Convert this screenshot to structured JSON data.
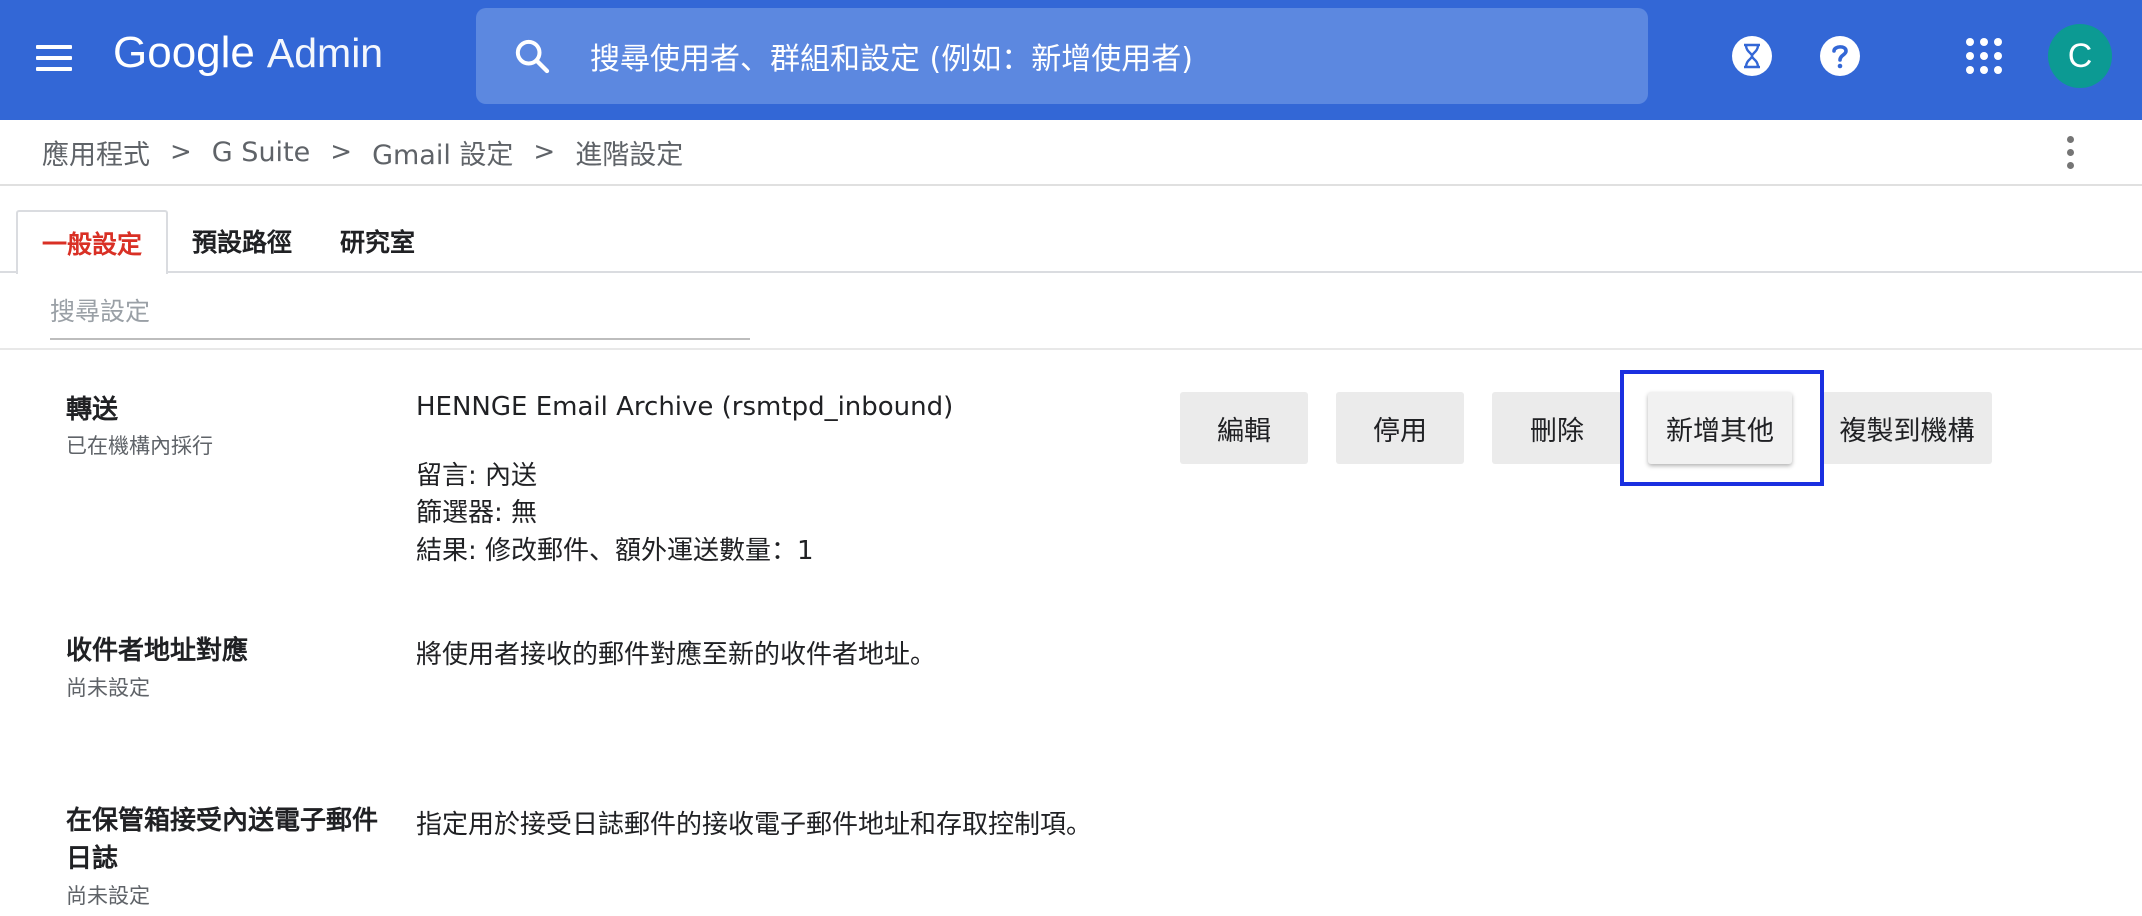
{
  "header": {
    "logo_google": "Google",
    "logo_admin": "Admin",
    "search_placeholder": "搜尋使用者、群組和設定 (例如：新增使用者)",
    "avatar_letter": "C",
    "icons": [
      "menu-icon",
      "search-icon",
      "hourglass-icon",
      "help-icon",
      "apps-icon"
    ]
  },
  "breadcrumb": {
    "items": [
      "應用程式",
      "G Suite",
      "Gmail 設定",
      "進階設定"
    ],
    "separator": ">"
  },
  "tabs": [
    {
      "label": "一般設定",
      "active": true
    },
    {
      "label": "預設路徑",
      "active": false
    },
    {
      "label": "研究室",
      "active": false
    }
  ],
  "settings_search": {
    "placeholder": "搜尋設定"
  },
  "settings": [
    {
      "title": "轉送",
      "status": "已在機構內採行",
      "rule_name": "HENNGE Email Archive (rsmtpd_inbound)",
      "details": [
        "留言:  內送",
        "篩選器:  無",
        "結果:  修改郵件、額外運送數量：1"
      ],
      "buttons": [
        "編輯",
        "停用",
        "刪除",
        "新增其他",
        "複製到機構"
      ]
    },
    {
      "title": "收件者地址對應",
      "status": "尚未設定",
      "description": "將使用者接收的郵件對應至新的收件者地址。"
    },
    {
      "title_line1": "在保管箱接受內送電子郵件",
      "title_line2": "日誌",
      "status": "尚未設定",
      "description": "指定用於接受日誌郵件的接收電子郵件地址和存取控制項。"
    }
  ],
  "colors": {
    "topbar": "#3367d6",
    "search_bg": "#5c88e0",
    "avatar": "#0c9a93",
    "active_tab": "#d93025",
    "highlight": "#1a2fe0"
  }
}
